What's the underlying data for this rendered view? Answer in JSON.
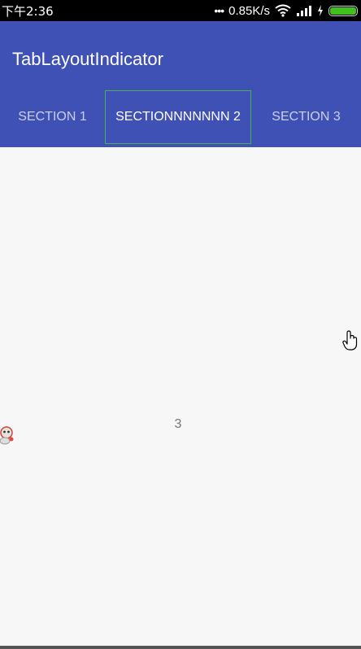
{
  "status_bar": {
    "time": "下午2:36",
    "dots": "•••",
    "network_speed": "0.85K/s",
    "icons": [
      "wifi-icon",
      "signal-icon",
      "charging-icon",
      "battery-icon"
    ],
    "battery_level": 1.0,
    "battery_color": "#3fc01f"
  },
  "app_bar": {
    "title": "TabLayoutIndicator",
    "color": "#3f51b5"
  },
  "tabs": [
    {
      "label": "SECTION 1",
      "selected": false
    },
    {
      "label": "SECTIONNNNNNN 2",
      "selected": true
    },
    {
      "label": "SECTION 3",
      "selected": false
    }
  ],
  "indicator_color": "#4caf50",
  "content": {
    "text": "3"
  }
}
